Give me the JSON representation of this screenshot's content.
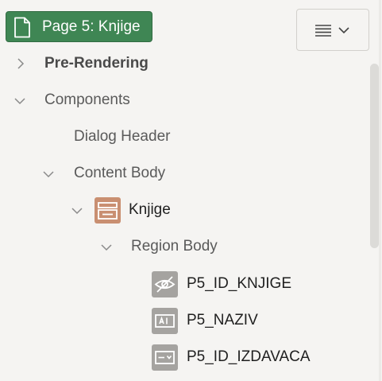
{
  "page_badge": {
    "label": "Page 5: Knjige",
    "icon": "page-document-icon"
  },
  "menu_button": {
    "icon": "hamburger-menu-icon",
    "dropdown_icon": "chevron-down-icon"
  },
  "tree": {
    "pre_rendering": "Pre-Rendering",
    "components": "Components",
    "dialog_header": "Dialog Header",
    "content_body": "Content Body",
    "region_knjige": "Knjige",
    "region_body": "Region Body",
    "items": [
      "P5_ID_KNJIGE",
      "P5_NAZIV",
      "P5_ID_IZDAVACA"
    ]
  },
  "colors": {
    "badge_green": "#3f8654",
    "region_icon": "#c98f71",
    "item_icon": "#a5a3a0",
    "background": "#f5f4f2"
  }
}
